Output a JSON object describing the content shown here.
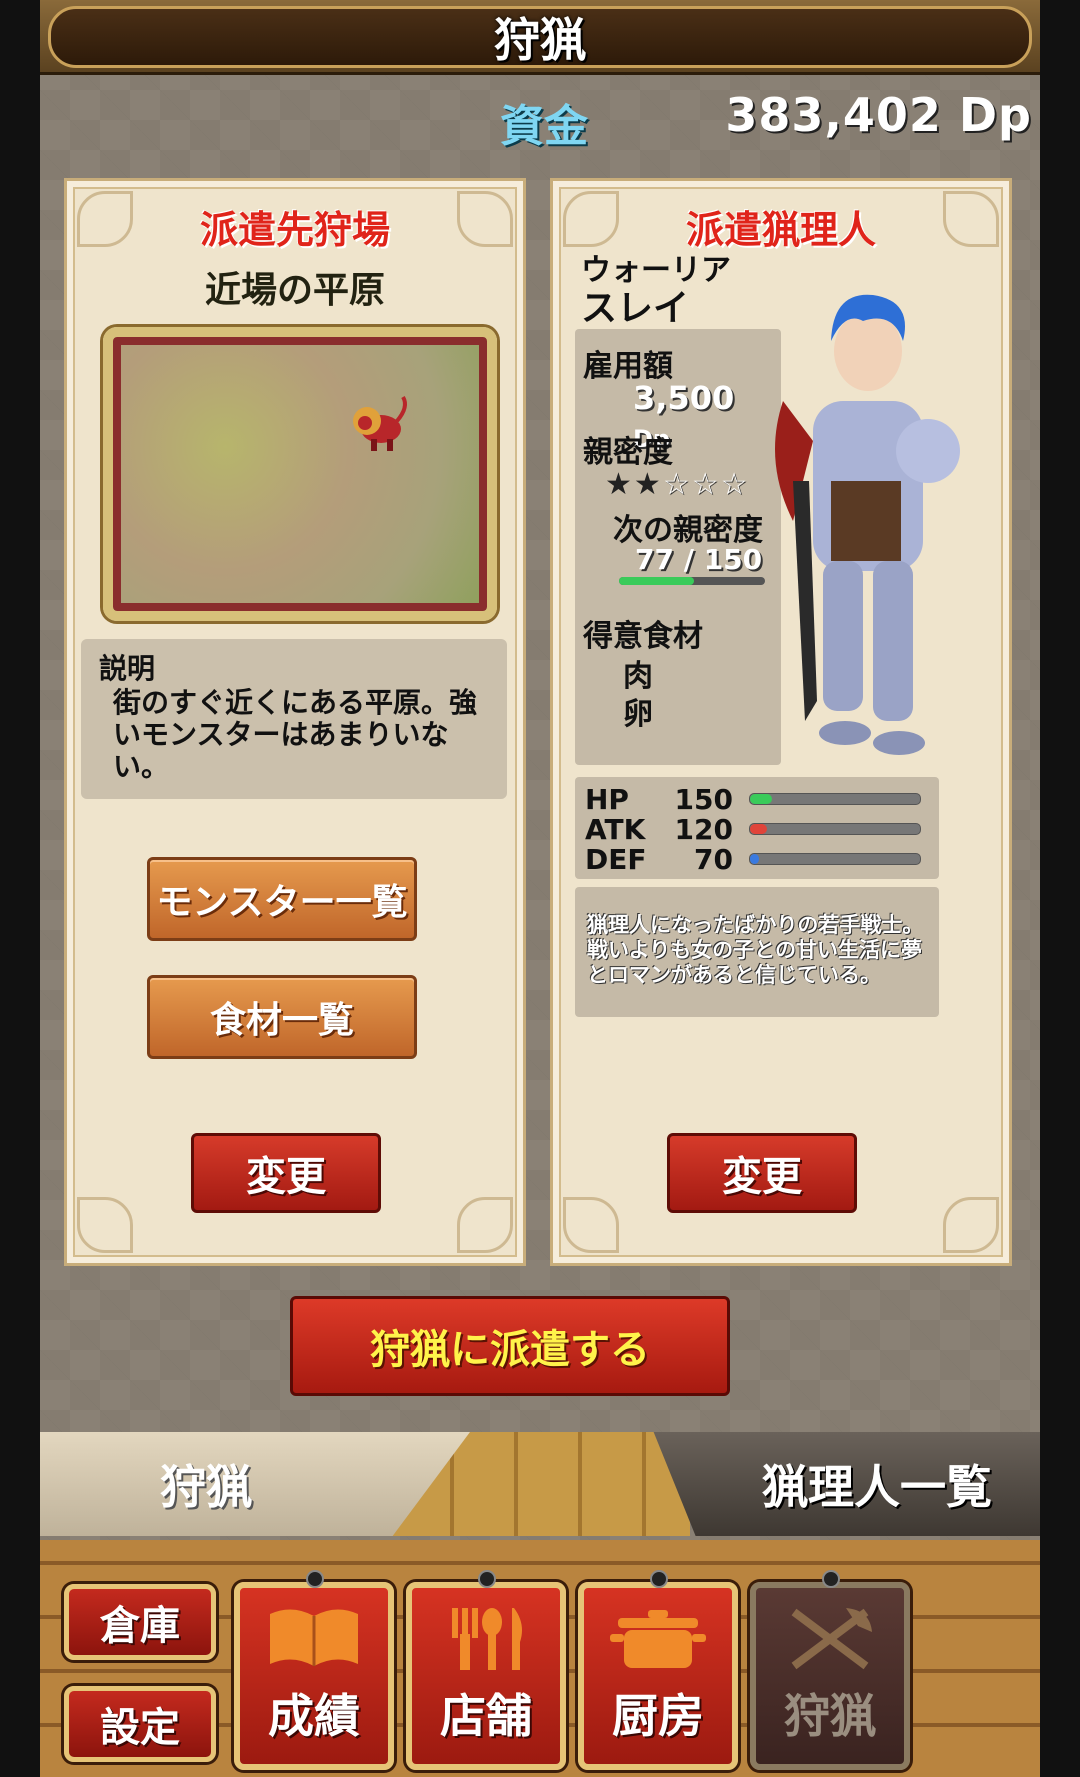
{
  "header": {
    "title": "狩猟"
  },
  "funds": {
    "label": "資金",
    "value": "383,402 Dp"
  },
  "left_panel": {
    "heading": "派遣先狩場",
    "field_name": "近場の平原",
    "description_title": "説明",
    "description_text": "街のすぐ近くにある平原。強いモンスターはあまりいない。",
    "monster_list_label": "モンスター一覧",
    "ingredient_list_label": "食材一覧",
    "change_label": "変更"
  },
  "right_panel": {
    "heading": "派遣猟理人",
    "job": "ウォーリア",
    "name": "スレイ",
    "hire_label": "雇用額",
    "hire_value": "3,500",
    "hire_unit": "Dp",
    "affinity_label": "親密度",
    "affinity_stars": {
      "filled": 2,
      "total": 5
    },
    "next_affinity_label": "次の親密度",
    "next_affinity_value": "77 / 150",
    "next_affinity_progress": 0.513,
    "specialty_label": "得意食材",
    "specialty_1": "肉",
    "specialty_2": "卵",
    "stats": [
      {
        "name": "HP",
        "value": "150",
        "fraction": 0.13,
        "color": "#3acb5a"
      },
      {
        "name": "ATK",
        "value": "120",
        "fraction": 0.1,
        "color": "#e0443a"
      },
      {
        "name": "DEF",
        "value": "70",
        "fraction": 0.05,
        "color": "#3a7ae0"
      }
    ],
    "profile": "猟理人になったばかりの若手戦士。戦いよりも女の子との甘い生活に夢とロマンがあると信じている。",
    "change_label": "変更"
  },
  "dispatch_label": "狩猟に派遣する",
  "tabs": {
    "left": "狩猟",
    "right": "猟理人一覧"
  },
  "bottom_menu": {
    "storage": "倉庫",
    "settings": "設定",
    "records": "成績",
    "store": "店舗",
    "kitchen": "厨房",
    "hunting": "狩猟"
  }
}
